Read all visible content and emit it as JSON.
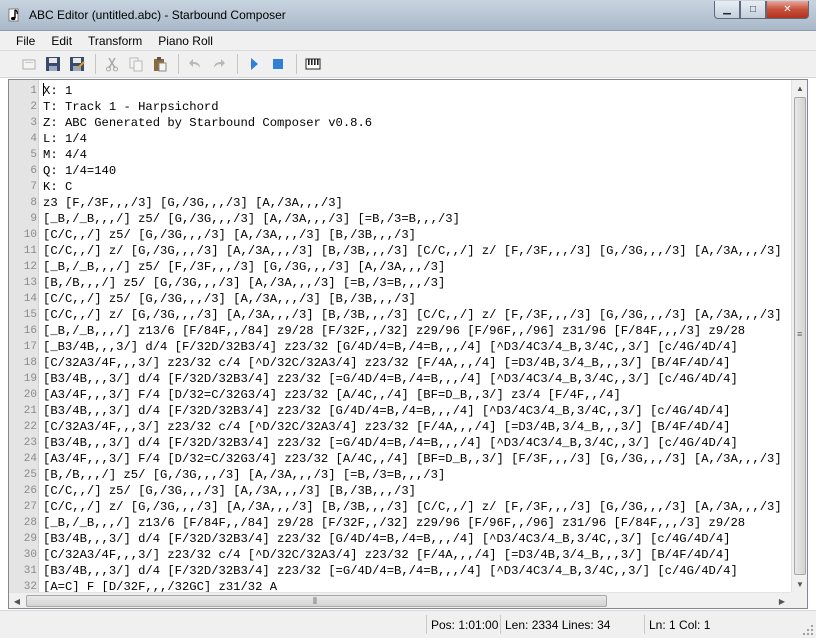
{
  "window": {
    "title": "ABC Editor (untitled.abc) - Starbound Composer",
    "minimize_glyph": "▁",
    "maximize_glyph": "□",
    "close_glyph": "✕"
  },
  "menu": [
    "File",
    "Edit",
    "Transform",
    "Piano Roll"
  ],
  "toolbar": {
    "buttons": [
      "new-icon",
      "save-icon",
      "save-as-icon",
      "cut-icon",
      "copy-icon",
      "paste-icon",
      "undo-icon",
      "redo-icon",
      "play-icon",
      "stop-icon",
      "piano-icon"
    ]
  },
  "editor": {
    "line_numbers": [
      "1",
      "2",
      "3",
      "4",
      "5",
      "6",
      "7",
      "8",
      "9",
      "10",
      "11",
      "12",
      "13",
      "14",
      "15",
      "16",
      "17",
      "18",
      "19",
      "20",
      "21",
      "22",
      "23",
      "24",
      "25",
      "26",
      "27",
      "28",
      "29",
      "30",
      "31",
      "32"
    ],
    "lines": [
      "X: 1",
      "T: Track 1 - Harpsichord",
      "Z: ABC Generated by Starbound Composer v0.8.6",
      "L: 1/4",
      "M: 4/4",
      "Q: 1/4=140",
      "K: C",
      "z3 [F,/3F,,,/3] [G,/3G,,,/3] [A,/3A,,,/3]",
      "[_B,/_B,,,/] z5/ [G,/3G,,,/3] [A,/3A,,,/3] [=B,/3=B,,,/3]",
      "[C/C,,/] z5/ [G,/3G,,,/3] [A,/3A,,,/3] [B,/3B,,,/3]",
      "[C/C,,/] z/ [G,/3G,,,/3] [A,/3A,,,/3] [B,/3B,,,/3] [C/C,,/] z/ [F,/3F,,,/3] [G,/3G,,,/3] [A,/3A,,,/3]",
      "[_B,/_B,,,/] z5/ [F,/3F,,,/3] [G,/3G,,,/3] [A,/3A,,,/3]",
      "[B,/B,,,/] z5/ [G,/3G,,,/3] [A,/3A,,,/3] [=B,/3=B,,,/3]",
      "[C/C,,/] z5/ [G,/3G,,,/3] [A,/3A,,,/3] [B,/3B,,,/3]",
      "[C/C,,/] z/ [G,/3G,,,/3] [A,/3A,,,/3] [B,/3B,,,/3] [C/C,,/] z/ [F,/3F,,,/3] [G,/3G,,,/3] [A,/3A,,,/3]",
      "[_B,/_B,,,/] z13/6 [F/84F,,/84] z9/28 [F/32F,,/32] z29/96 [F/96F,,/96] z31/96 [F/84F,,,/3] z9/28",
      "[_B3/4B,,,3/] d/4 [F/32D/32B3/4] z23/32 [G/4D/4=B,/4=B,,,/4] [^D3/4C3/4_B,3/4C,,3/] [c/4G/4D/4]",
      "[C/32A3/4F,,,3/] z23/32 c/4 [^D/32C/32A3/4] z23/32 [F/4A,,,/4] [=D3/4B,3/4_B,,,3/] [B/4F/4D/4]",
      "[B3/4B,,,3/] d/4 [F/32D/32B3/4] z23/32 [=G/4D/4=B,/4=B,,,/4] [^D3/4C3/4_B,3/4C,,3/] [c/4G/4D/4]",
      "[A3/4F,,,3/] F/4 [D/32=C/32G3/4] z23/32 [A/4C,,/4] [BF=D_B,,3/] z3/4 [F/4F,,/4]",
      "[B3/4B,,,3/] d/4 [F/32D/32B3/4] z23/32 [G/4D/4=B,/4=B,,,/4] [^D3/4C3/4_B,3/4C,,3/] [c/4G/4D/4]",
      "[C/32A3/4F,,,3/] z23/32 c/4 [^D/32C/32A3/4] z23/32 [F/4A,,,/4] [=D3/4B,3/4_B,,,3/] [B/4F/4D/4]",
      "[B3/4B,,,3/] d/4 [F/32D/32B3/4] z23/32 [=G/4D/4=B,/4=B,,,/4] [^D3/4C3/4_B,3/4C,,3/] [c/4G/4D/4]",
      "[A3/4F,,,3/] F/4 [D/32=C/32G3/4] z23/32 [A/4C,,/4] [BF=D_B,,3/] [F/3F,,,/3] [G,/3G,,,/3] [A,/3A,,,/3]",
      "[B,/B,,,/] z5/ [G,/3G,,,/3] [A,/3A,,,/3] [=B,/3=B,,,/3]",
      "[C/C,,/] z5/ [G,/3G,,,/3] [A,/3A,,,/3] [B,/3B,,,/3]",
      "[C/C,,/] z/ [G,/3G,,,/3] [A,/3A,,,/3] [B,/3B,,,/3] [C/C,,/] z/ [F,/3F,,,/3] [G,/3G,,,/3] [A,/3A,,,/3]",
      "[_B,/_B,,,/] z13/6 [F/84F,,/84] z9/28 [F/32F,,/32] z29/96 [F/96F,,/96] z31/96 [F/84F,,,/3] z9/28",
      "[B3/4B,,,3/] d/4 [F/32D/32B3/4] z23/32 [G/4D/4=B,/4=B,,,/4] [^D3/4C3/4_B,3/4C,,3/] [c/4G/4D/4]",
      "[C/32A3/4F,,,3/] z23/32 c/4 [^D/32C/32A3/4] z23/32 [F/4A,,,/4] [=D3/4B,3/4_B,,,3/] [B/4F/4D/4]",
      "[B3/4B,,,3/] d/4 [F/32D/32B3/4] z23/32 [=G/4D/4=B,/4=B,,,/4] [^D3/4C3/4_B,3/4C,,3/] [c/4G/4D/4]",
      "[A=C] F [D/32F,,,/32GC] z31/32 A"
    ]
  },
  "status": {
    "pos": "Pos: 1:01:00",
    "len_lines": "Len: 2334 Lines: 34",
    "ln_col": "Ln: 1 Col: 1"
  }
}
